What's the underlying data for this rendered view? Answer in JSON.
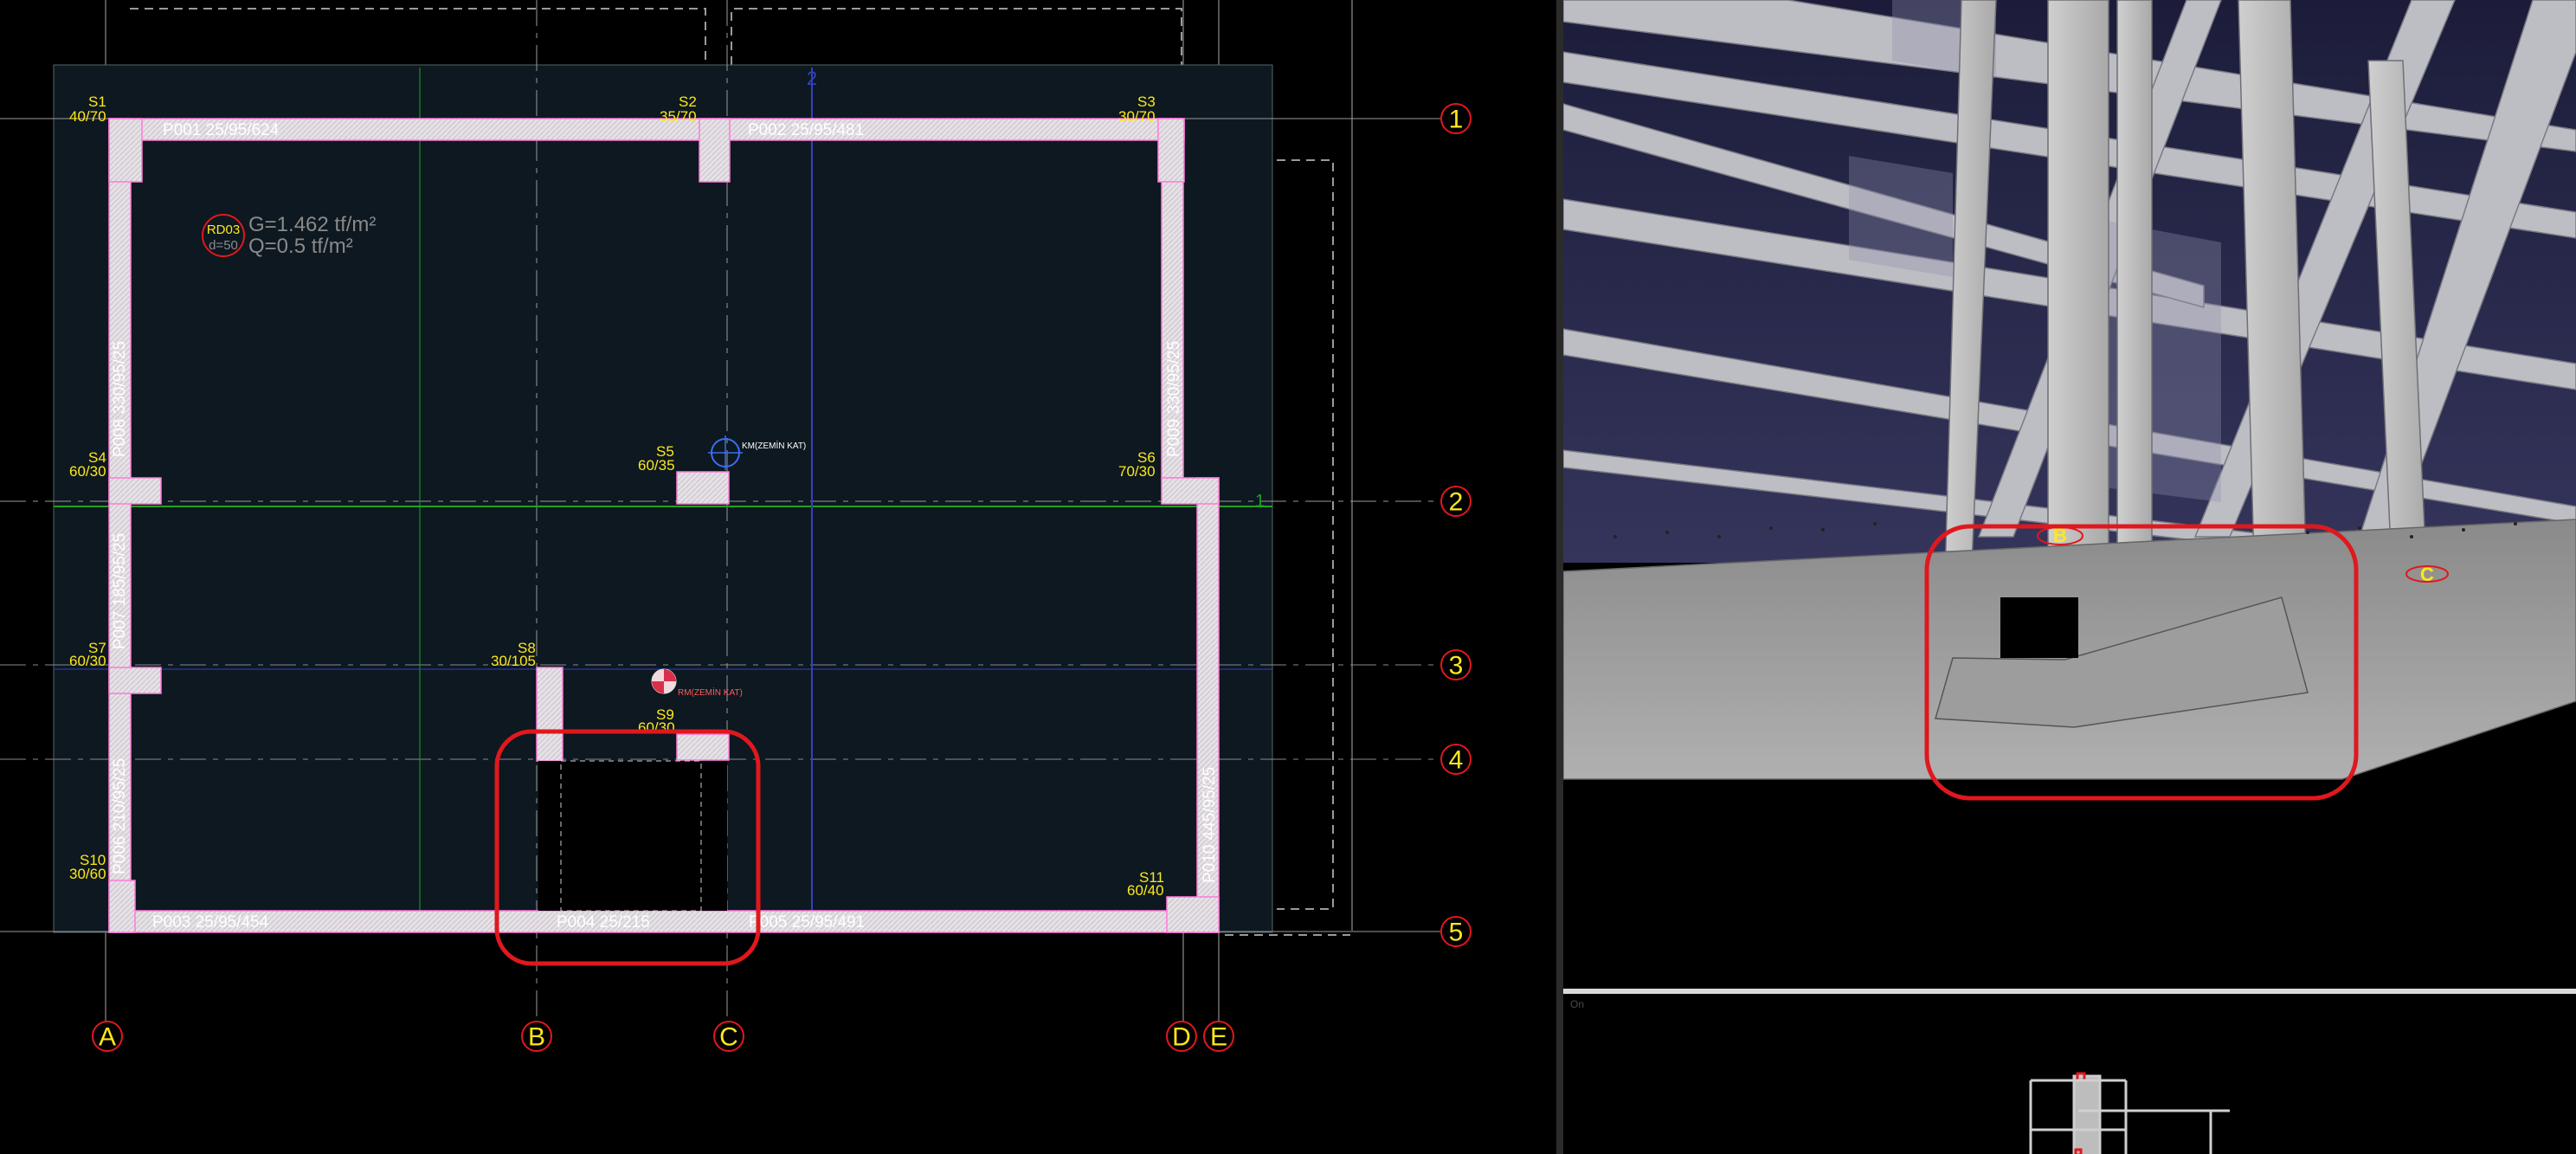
{
  "plan": {
    "top_axis_label": "2",
    "grid_right_label": "1",
    "beams": [
      "P001 25/95/624",
      "P002 25/95/481",
      "P003 25/95/454",
      "P004 25/215",
      "P005 25/95/491",
      "P006 210/95/25",
      "P007 185/95/25",
      "P008 330/95/25",
      "P009 330/95/25",
      "P010 445/95/25"
    ],
    "columns": [
      {
        "name": "S1",
        "size": "40/70"
      },
      {
        "name": "S2",
        "size": "35/70"
      },
      {
        "name": "S3",
        "size": "30/70"
      },
      {
        "name": "S4",
        "size": "60/30"
      },
      {
        "name": "S5",
        "size": "60/35"
      },
      {
        "name": "S6",
        "size": "70/30"
      },
      {
        "name": "S7",
        "size": "60/30"
      },
      {
        "name": "S8",
        "size": "30/105"
      },
      {
        "name": "S9",
        "size": "60/30"
      },
      {
        "name": "S10",
        "size": "30/60"
      },
      {
        "name": "S11",
        "size": "60/40"
      }
    ],
    "axes_row": [
      "1",
      "2",
      "3",
      "4",
      "5"
    ],
    "axes_col": [
      "A",
      "B",
      "C",
      "D",
      "E"
    ],
    "slab": {
      "name": "RD03",
      "thickness": "d=50",
      "dead_load": "G=1.462 tf/m²",
      "live_load": "Q=0.5 tf/m²"
    },
    "markers": [
      {
        "text": "KM(ZEMİN KAT)"
      },
      {
        "text": "RM(ZEMİN KAT)"
      }
    ]
  },
  "view3d": {
    "axis_markers": [
      "B",
      "C"
    ]
  },
  "minimap": {
    "label": "On"
  },
  "colors": {
    "background": "#000000",
    "plan_fill": "#0d1820",
    "beam_fill": "#e6e1e6",
    "beam_edge": "#ff7ad9",
    "label_yellow": "#ffe81a",
    "axis_red": "#e0181e",
    "highlight": "#e0181e",
    "grid_green": "#1fa31f",
    "grid_blue": "#3440c0"
  }
}
